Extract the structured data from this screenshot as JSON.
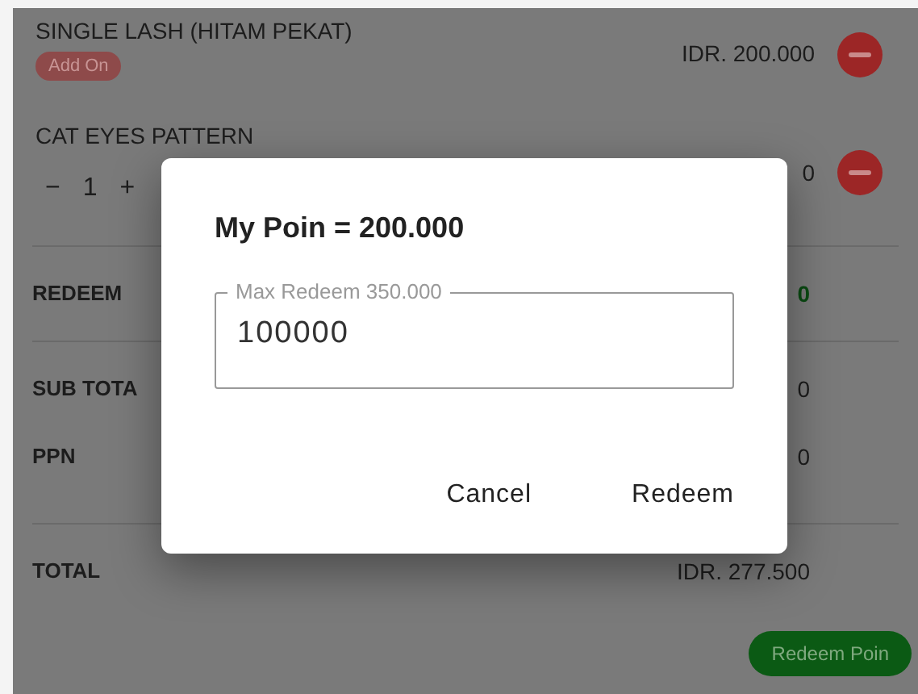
{
  "items": [
    {
      "name": "SINGLE LASH (HITAM PEKAT)",
      "badge": "Add On",
      "price": "IDR. 200.000"
    },
    {
      "name": "CAT EYES PATTERN",
      "stepper": {
        "minus": "−",
        "quantity": "1",
        "plus": "+"
      },
      "price": "0"
    }
  ],
  "summary_sections": [
    {
      "rows": [
        {
          "label": "REDEEM",
          "value": "0",
          "kind": "discount"
        }
      ]
    },
    {
      "rows": [
        {
          "label": "SUB TOTA",
          "value": "0",
          "kind": "plain"
        },
        {
          "label": "PPN",
          "value": "0",
          "kind": "plain"
        }
      ]
    },
    {
      "rows": [
        {
          "label": "TOTAL",
          "value": "IDR. 277.500",
          "kind": "plain"
        }
      ]
    }
  ],
  "redeem_button": "Redeem Poin",
  "dialog": {
    "title": "My Poin = 200.000",
    "field": {
      "label": "Max Redeem 350.000",
      "value": "100000"
    },
    "buttons": [
      "Cancel",
      "Redeem"
    ]
  }
}
